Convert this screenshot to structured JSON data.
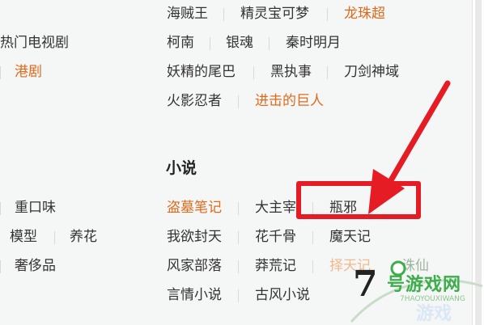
{
  "sections": {
    "anime_rows": [
      [
        "海贼王",
        "精灵宝可梦",
        "龙珠超"
      ],
      [
        "柯南",
        "银魂",
        "秦时明月"
      ],
      [
        "妖精的尾巴",
        "黑执事",
        "刀剑神域"
      ],
      [
        "火影忍者",
        "进击的巨人"
      ]
    ],
    "left_column": {
      "tv_category": "热门电视剧",
      "tv_item": "港剧",
      "misc_items": [
        "重口味",
        "模型",
        "养花",
        "奢侈品"
      ]
    },
    "novel": {
      "heading": "小说",
      "rows": [
        [
          "盗墓笔记",
          "大主宰",
          "瓶邪"
        ],
        [
          "我欲封天",
          "花千骨",
          "魔天记"
        ],
        [
          "风家部落",
          "莽荒记",
          "择天记",
          "诛仙"
        ],
        [
          "言情小说",
          "古风小说"
        ]
      ]
    }
  },
  "annotation": {
    "highlight_color": "#e51c23",
    "target": "瓶邪"
  },
  "watermark": {
    "logo_number": "7",
    "domain": "号游戏网",
    "sub": "7HAOYOUXIWANG",
    "tag": "游戏"
  },
  "colors": {
    "link": "#333333",
    "hot_link": "#e06a1b",
    "background": "#f5f6f6"
  }
}
